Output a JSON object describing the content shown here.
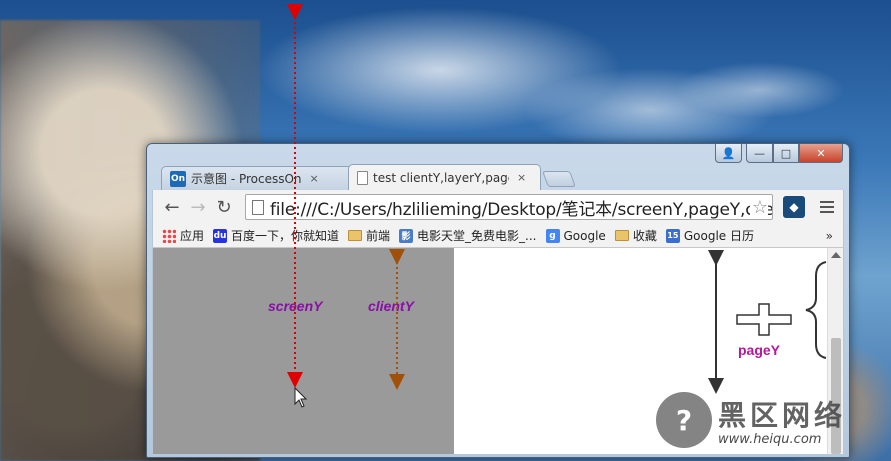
{
  "window": {
    "controls": {
      "user": "👤",
      "minimize": "—",
      "maximize": "□",
      "close": "✕"
    }
  },
  "tabs": [
    {
      "favicon": "On",
      "title": "示意图 - ProcessOn",
      "close": "×"
    },
    {
      "title": "test clientY,layerY,pageY",
      "close": "×",
      "active": true
    }
  ],
  "toolbar": {
    "back": "←",
    "forward": "→",
    "reload": "↻",
    "url": "file:///C:/Users/hzlilieming/Desktop/笔记本/screenY,pageY,clientY",
    "star": "☆"
  },
  "bookmarks": {
    "items": [
      {
        "label": "应用",
        "icon": "apps-icon"
      },
      {
        "label": "百度一下，你就知道",
        "icon": "baidu-icon",
        "icon_text": "du"
      },
      {
        "label": "前端",
        "icon": "folder-icon"
      },
      {
        "label": "电影天堂_免费电影_...",
        "icon": "movie-icon",
        "icon_text": "影"
      },
      {
        "label": "Google",
        "icon": "google-icon",
        "icon_text": "g"
      },
      {
        "label": "收藏",
        "icon": "folder-icon"
      },
      {
        "label": "Google 日历",
        "icon": "calendar-icon",
        "icon_text": "15"
      }
    ],
    "more": "»"
  },
  "page": {
    "screen_label": "screenY",
    "client_label": "clientY",
    "page_label": "pageY"
  },
  "watermark": {
    "logo": "?",
    "text": "黑区网络",
    "url": "www.heiqu.com"
  },
  "colors": {
    "screen_arrow": "#e00000",
    "client_arrow": "#a05008",
    "page_arrow": "#333333",
    "label_purple": "#8a0fa8"
  }
}
